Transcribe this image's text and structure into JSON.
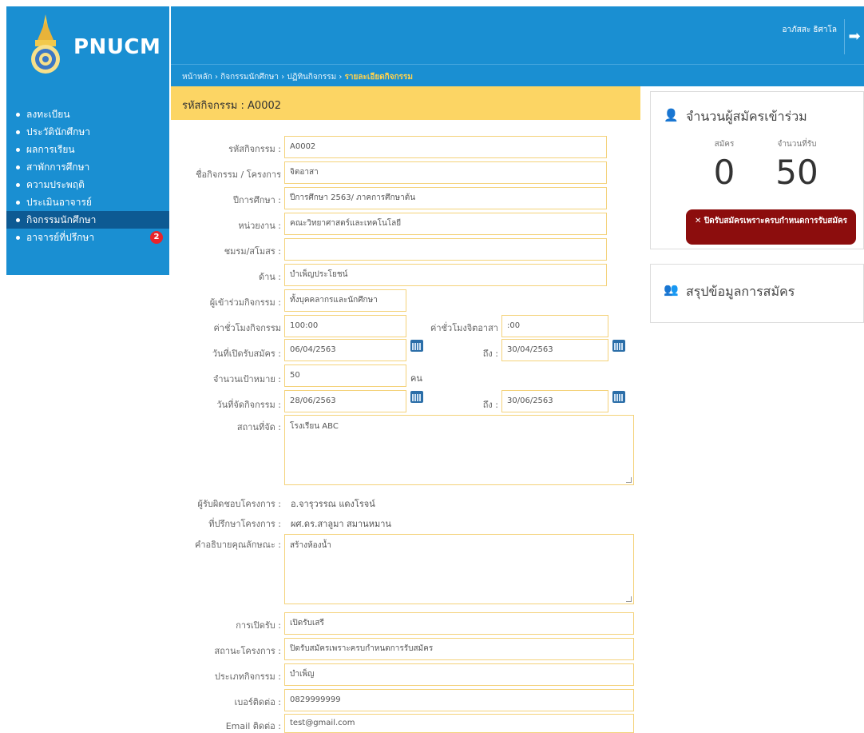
{
  "app": {
    "logo_text": "PNUCM"
  },
  "header": {
    "user_name": "อาภัสสะ ธิศาโล",
    "logout_icon": "arrow-right-icon"
  },
  "breadcrumb": {
    "home": "หน้าหลัก",
    "sep": "›",
    "level2": "กิจกรรมนักศึกษา",
    "level3": "ปฏิทินกิจกรรม",
    "current": "รายละเอียดกิจกรรม"
  },
  "sidebar": {
    "items": [
      {
        "label": "ลงทะเบียน"
      },
      {
        "label": "ประวัตินักศึกษา"
      },
      {
        "label": "ผลการเรียน"
      },
      {
        "label": "สาพักการศึกษา"
      },
      {
        "label": "ความประพฤติ"
      },
      {
        "label": "ประเมินอาจารย์"
      },
      {
        "label": "กิจกรรมนักศึกษา"
      },
      {
        "label": "อาจารย์ที่ปรึกษา",
        "badge": "2"
      }
    ]
  },
  "activity": {
    "header": "รหัสกิจกรรม : A0002",
    "fields": {
      "code": {
        "label": "รหัสกิจกรรม :",
        "value": "A0002"
      },
      "name": {
        "label": "ชื่อกิจกรรม / โครงการ",
        "value": "จิตอาสา"
      },
      "year": {
        "label": "ปีการศึกษา :",
        "value": "ปีการศึกษา 2563/ ภาคการศึกษาต้น"
      },
      "unit": {
        "label": "หน่วยงาน :",
        "value": "คณะวิทยาศาสตร์และเทคโนโลยี"
      },
      "club": {
        "label": "ชมรม/สโมสร :",
        "value": ""
      },
      "aspect": {
        "label": "ด้าน :",
        "value": "บำเพ็ญประโยชน์"
      },
      "participants": {
        "label": "ผู้เข้าร่วมกิจกรรม :",
        "value": "ทั้งบุคคลากรและนักศึกษา"
      },
      "hours": {
        "label": "ค่าชั่วโมงกิจกรรม",
        "value": "100:00"
      },
      "volunteer_hours": {
        "label": "ค่าชั่วโมงจิตอาสา",
        "value": ":00"
      },
      "reg_start": {
        "label": "วันที่เปิดรับสมัคร :",
        "value": "06/04/2563"
      },
      "reg_end": {
        "label": "ถึง :",
        "value": "30/04/2563"
      },
      "target": {
        "label": "จำนวนเป้าหมาย :",
        "value": "50",
        "unit": "คน"
      },
      "event_start": {
        "label": "วันที่จัดกิจกรรม :",
        "value": "28/06/2563"
      },
      "event_end": {
        "label": "ถึง :",
        "value": "30/06/2563"
      },
      "venue": {
        "label": "สถานที่จัด :",
        "value": "โรงเรียน ABC"
      },
      "owner": {
        "label": "ผู้รับผิดชอบโครงการ :",
        "value": "อ.จารุวรรณ แดงโรจน์"
      },
      "advisor": {
        "label": "ที่ปรึกษาโครงการ :",
        "value": "ผศ.ดร.สาลูมา สมานหมาน"
      },
      "description": {
        "label": "คำอธิบายคุณลักษณะ :",
        "value": "สร้างห้องน้ำ"
      },
      "opening": {
        "label": "การเปิดรับ :",
        "value": "เปิดรับเสรี"
      },
      "status": {
        "label": "สถานะโครงการ :",
        "value": "ปิดรับสมัครเพราะครบกำหนดการรับสมัคร"
      },
      "type": {
        "label": "ประเภทกิจกรรม :",
        "value": "บำเพ็ญ"
      },
      "phone": {
        "label": "เบอร์ติดต่อ :",
        "value": "0829999999"
      },
      "email": {
        "label": "Email ติดต่อ :",
        "value": "test@gmail.com"
      }
    }
  },
  "applicants_panel": {
    "title": "จำนวนผู้สมัครเข้าร่วม",
    "icon": "user-icon",
    "applied_label": "สมัคร",
    "applied_value": "0",
    "capacity_label": "จำนวนที่รับ",
    "capacity_value": "50",
    "closed_button": "✕ ปิดรับสมัครเพราะครบกำหนดการรับสมัคร"
  },
  "summary_panel": {
    "title": "สรุปข้อมูลการสมัคร",
    "icon": "users-icon"
  },
  "colors": {
    "primary": "#1a8fd2",
    "sidebar_active": "#0d5a93",
    "accent_yellow": "#fcd564",
    "badge_red": "#e8242b",
    "closed_red": "#8c0d0d",
    "field_border": "#f4d27a"
  }
}
